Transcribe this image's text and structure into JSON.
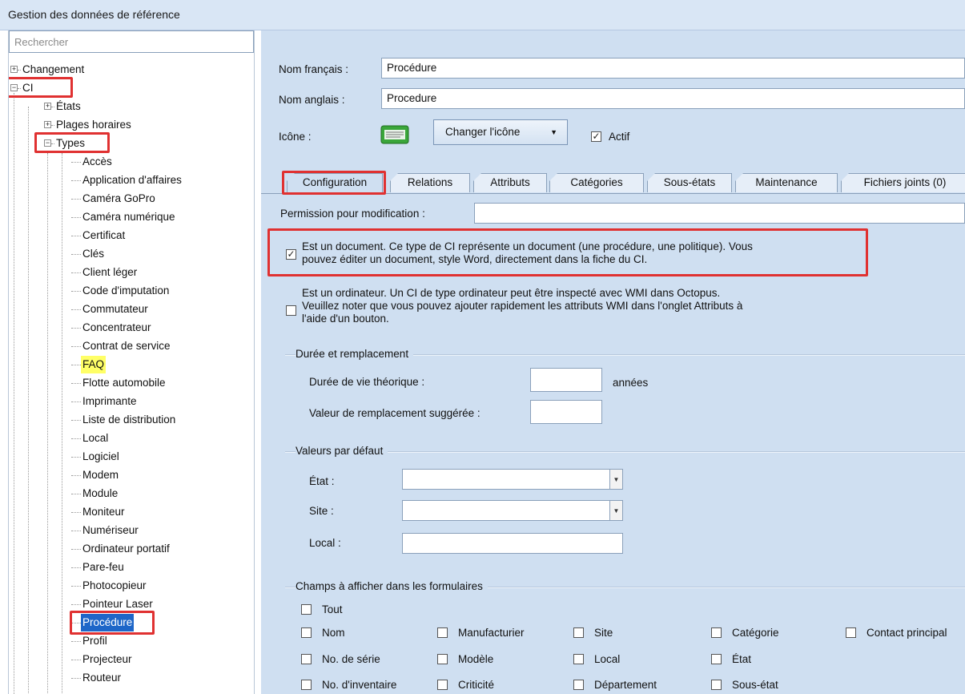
{
  "window": {
    "title": "Gestion des données de référence"
  },
  "sidebar": {
    "search_placeholder": "Rechercher",
    "tree": {
      "changement": "Changement",
      "ci": "CI",
      "etats": "États",
      "plages": "Plages horaires",
      "types": "Types",
      "items": [
        "Accès",
        "Application d'affaires",
        "Caméra GoPro",
        "Caméra numérique",
        "Certificat",
        "Clés",
        "Client léger",
        "Code d'imputation",
        "Commutateur",
        "Concentrateur",
        "Contrat de service",
        "FAQ",
        "Flotte automobile",
        "Imprimante",
        "Liste de distribution",
        "Local",
        "Logiciel",
        "Modem",
        "Module",
        "Moniteur",
        "Numériseur",
        "Ordinateur portatif",
        "Pare-feu",
        "Photocopieur",
        "Pointeur Laser",
        "Procédure",
        "Profil",
        "Projecteur",
        "Routeur"
      ]
    }
  },
  "form": {
    "nom_francais_label": "Nom français :",
    "nom_francais_value": "Procédure",
    "nom_anglais_label": "Nom anglais :",
    "nom_anglais_value": "Procedure",
    "icone_label": "Icône :",
    "changer_icone": "Changer l'icône",
    "actif_label": "Actif"
  },
  "tabs": [
    "Configuration",
    "Relations",
    "Attributs",
    "Catégories",
    "Sous-états",
    "Maintenance",
    "Fichiers joints (0)"
  ],
  "config": {
    "permission_label": "Permission pour modification :",
    "document_text": "Est un document. Ce type de CI représente un document (une procédure, une politique). Vous pouvez éditer un document, style Word, directement dans la fiche du CI.",
    "document_line1": "Est un document. Ce type de CI représente un document (une procédure, une politique). Vous",
    "document_line2": "pouvez éditer un document, style Word, directement dans la fiche du CI.",
    "ordinateur_line1": "Est un ordinateur. Un CI de type ordinateur peut être inspecté avec WMI dans Octopus.",
    "ordinateur_line2": "Veuillez noter que vous pouvez ajouter rapidement les attributs WMI dans l'onglet Attributs à",
    "ordinateur_line3": "l'aide d'un bouton.",
    "duree_group": "Durée et remplacement",
    "duree_vie": "Durée de vie théorique :",
    "annees": "années",
    "valeur_remplacement": "Valeur de remplacement suggérée :",
    "defaut_group": "Valeurs par défaut",
    "etat": "État :",
    "site": "Site :",
    "local": "Local :",
    "champs_group": "Champs à afficher dans les formulaires",
    "champs": {
      "tout": "Tout",
      "nom": "Nom",
      "manufacturier": "Manufacturier",
      "site": "Site",
      "categorie": "Catégorie",
      "contact": "Contact principal",
      "serie": "No. de série",
      "modele": "Modèle",
      "local": "Local",
      "etat": "État",
      "inventaire": "No. d'inventaire",
      "criticite": "Criticité",
      "departement": "Département",
      "sous_etat": "Sous-état"
    }
  }
}
